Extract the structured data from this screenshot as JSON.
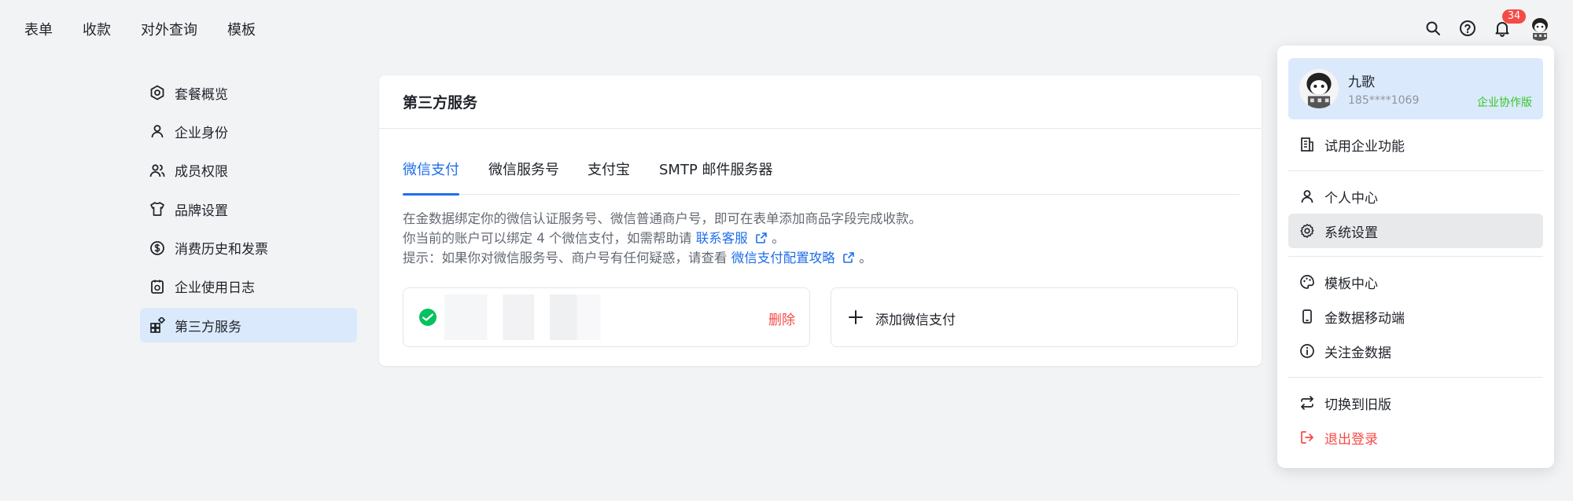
{
  "topnav": {
    "items": [
      "表单",
      "收款",
      "对外查询",
      "模板"
    ],
    "notification_count": "34"
  },
  "sidebar": {
    "items": [
      {
        "label": "套餐概览",
        "icon": "package-icon"
      },
      {
        "label": "企业身份",
        "icon": "user-icon"
      },
      {
        "label": "成员权限",
        "icon": "users-icon"
      },
      {
        "label": "品牌设置",
        "icon": "shirt-icon"
      },
      {
        "label": "消费历史和发票",
        "icon": "dollar-circle-icon"
      },
      {
        "label": "企业使用日志",
        "icon": "log-icon"
      },
      {
        "label": "第三方服务",
        "icon": "apps-icon"
      }
    ],
    "active_index": 6
  },
  "main": {
    "title": "第三方服务",
    "tabs": [
      "微信支付",
      "微信服务号",
      "支付宝",
      "SMTP 邮件服务器"
    ],
    "active_tab": 0,
    "desc_line1": "在金数据绑定你的微信认证服务号、微信普通商户号，即可在表单添加商品字段完成收款。",
    "desc_line2_prefix": "你当前的账户可以绑定 4 个微信支付，如需帮助请",
    "desc_line2_link": "联系客服",
    "desc_line2_suffix": "。",
    "desc_line3_prefix": "提示：如果你对微信服务号、商户号有任何疑惑，请查看",
    "desc_line3_link": "微信支付配置攻略",
    "desc_line3_suffix": "。",
    "delete_label": "删除",
    "add_label": "添加微信支付"
  },
  "dropdown": {
    "name": "九歌",
    "phone": "185****1069",
    "plan": "企业协作版",
    "items": [
      {
        "label": "试用企业功能",
        "icon": "building-icon"
      },
      {
        "label": "个人中心",
        "icon": "user-icon"
      },
      {
        "label": "系统设置",
        "icon": "gear-icon"
      },
      {
        "label": "模板中心",
        "icon": "palette-icon"
      },
      {
        "label": "金数据移动端",
        "icon": "mobile-icon"
      },
      {
        "label": "关注金数据",
        "icon": "info-icon"
      },
      {
        "label": "切换到旧版",
        "icon": "switch-icon"
      },
      {
        "label": "退出登录",
        "icon": "logout-icon"
      }
    ]
  },
  "colors": {
    "accent": "#1f6eeb",
    "danger": "#f54a45",
    "success": "#34c724",
    "active_bg": "#dbe9fc",
    "wechat_green": "#07c160"
  }
}
